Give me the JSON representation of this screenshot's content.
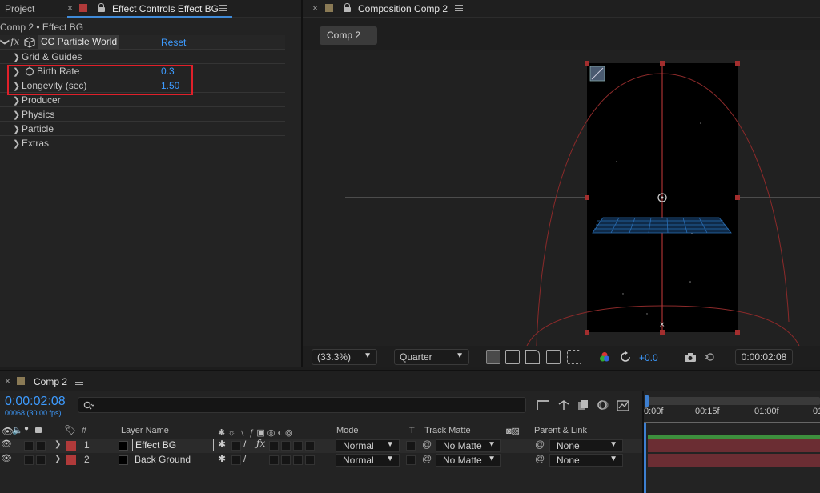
{
  "left_panel": {
    "tab_project": "Project",
    "tab_effect_controls": "Effect Controls Effect BG",
    "breadcrumb": "Comp 2 • Effect BG",
    "effect_name": "CC Particle World",
    "reset_label": "Reset",
    "fx_label": "fx",
    "rows": [
      {
        "label": "Grid & Guides"
      },
      {
        "label": "Birth Rate",
        "value": "0.3"
      },
      {
        "label": "Longevity (sec)",
        "value": "1.50"
      },
      {
        "label": "Producer"
      },
      {
        "label": "Physics"
      },
      {
        "label": "Particle"
      },
      {
        "label": "Extras"
      }
    ],
    "highlight_color": "#e0202a"
  },
  "comp_panel": {
    "tab_label": "Composition Comp 2",
    "comp_button": "Comp 2",
    "zoom": "(33.3%)",
    "resolution": "Quarter",
    "exposure": "+0.0",
    "timecode": "0:00:02:08"
  },
  "timeline": {
    "tab_label": "Comp 2",
    "timecode": "0:00:02:08",
    "frames": "00068 (30.00 fps)",
    "search_placeholder": "",
    "ruler": [
      "0:00f",
      "00:15f",
      "01:00f",
      "01"
    ],
    "columns": {
      "hash": "#",
      "layer_name": "Layer Name",
      "mode": "Mode",
      "t": "T",
      "track_matte": "Track Matte",
      "parent": "Parent & Link"
    },
    "layers": [
      {
        "num": "1",
        "name": "Effect BG",
        "mode": "Normal",
        "matte": "No Matte",
        "parent": "None",
        "color": "#b03a3a"
      },
      {
        "num": "2",
        "name": "Back Ground",
        "mode": "Normal",
        "matte": "No Matte",
        "parent": "None",
        "color": "#b03a3a"
      }
    ]
  }
}
